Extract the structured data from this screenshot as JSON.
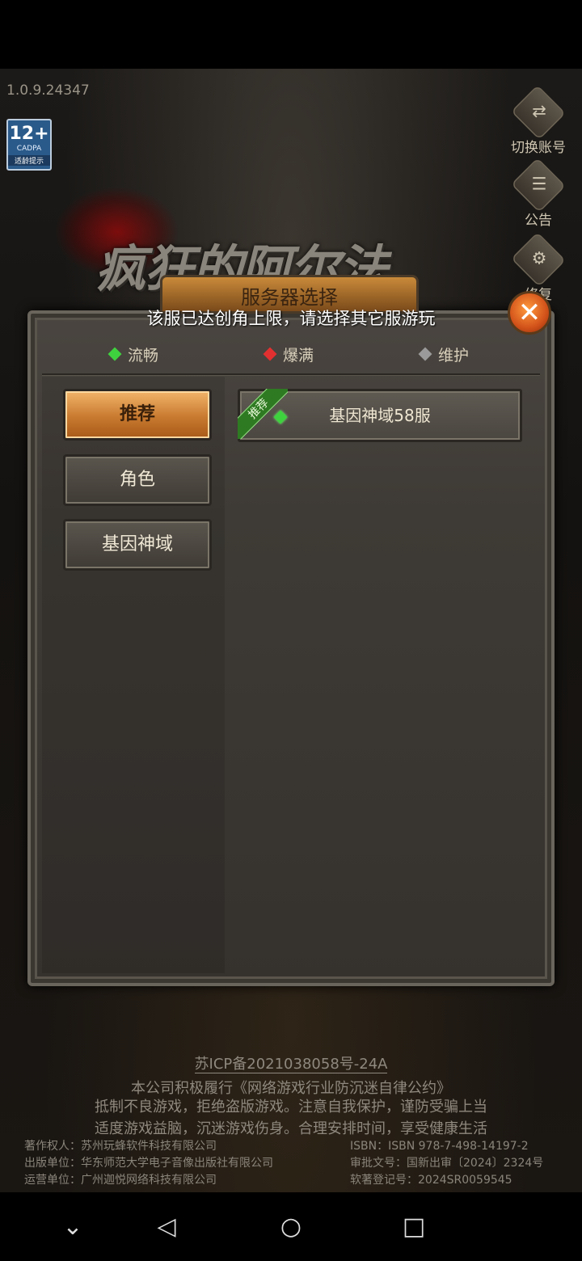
{
  "game": {
    "version": "1.0.9.24347",
    "age_rating": {
      "num": "12+",
      "org": "CADPA",
      "tip": "适龄提示"
    },
    "logo": "疯狂的阿尔法",
    "side_buttons": [
      {
        "label": "切换账号",
        "icon": "switch-account-icon",
        "glyph": "⇄"
      },
      {
        "label": "公告",
        "icon": "notice-icon",
        "glyph": "☰"
      },
      {
        "label": "修复",
        "icon": "repair-icon",
        "glyph": "⚙"
      }
    ]
  },
  "dialog": {
    "title": "服务器选择",
    "warning": "该服已达创角上限，请选择其它服游玩",
    "close": "✕",
    "legend": [
      {
        "label": "流畅",
        "color": "#3fd23f"
      },
      {
        "label": "爆满",
        "color": "#e23030"
      },
      {
        "label": "维护",
        "color": "#9a9a9a"
      }
    ],
    "tabs": [
      {
        "label": "推荐",
        "active": true
      },
      {
        "label": "角色",
        "active": false
      },
      {
        "label": "基因神域",
        "active": false
      }
    ],
    "servers": [
      {
        "name": "基因神域58服",
        "tag": "推荐",
        "status_color": "#3fd23f"
      }
    ]
  },
  "footer": {
    "icp": "苏ICP备2021038058号-24A",
    "line1": "本公司积极履行《网络游戏行业防沉迷自律公约》",
    "line2": "抵制不良游戏，拒绝盗版游戏。注意自我保护，谨防受骗上当",
    "line3": "适度游戏益脑，沉迷游戏伤身。合理安排时间，享受健康生活",
    "left_credits": [
      "著作权人：苏州玩蜂软件科技有限公司",
      "出版单位：华东师范大学电子音像出版社有限公司",
      "运营单位：广州迦悦网络科技有限公司"
    ],
    "right_credits": [
      "ISBN：ISBN 978-7-498-14197-2",
      "审批文号：国新出审〔2024〕2324号",
      "软著登记号：2024SR0059545"
    ]
  },
  "navbar": {
    "down": "⌄",
    "back": "◁",
    "home": "○",
    "recents": "□"
  }
}
